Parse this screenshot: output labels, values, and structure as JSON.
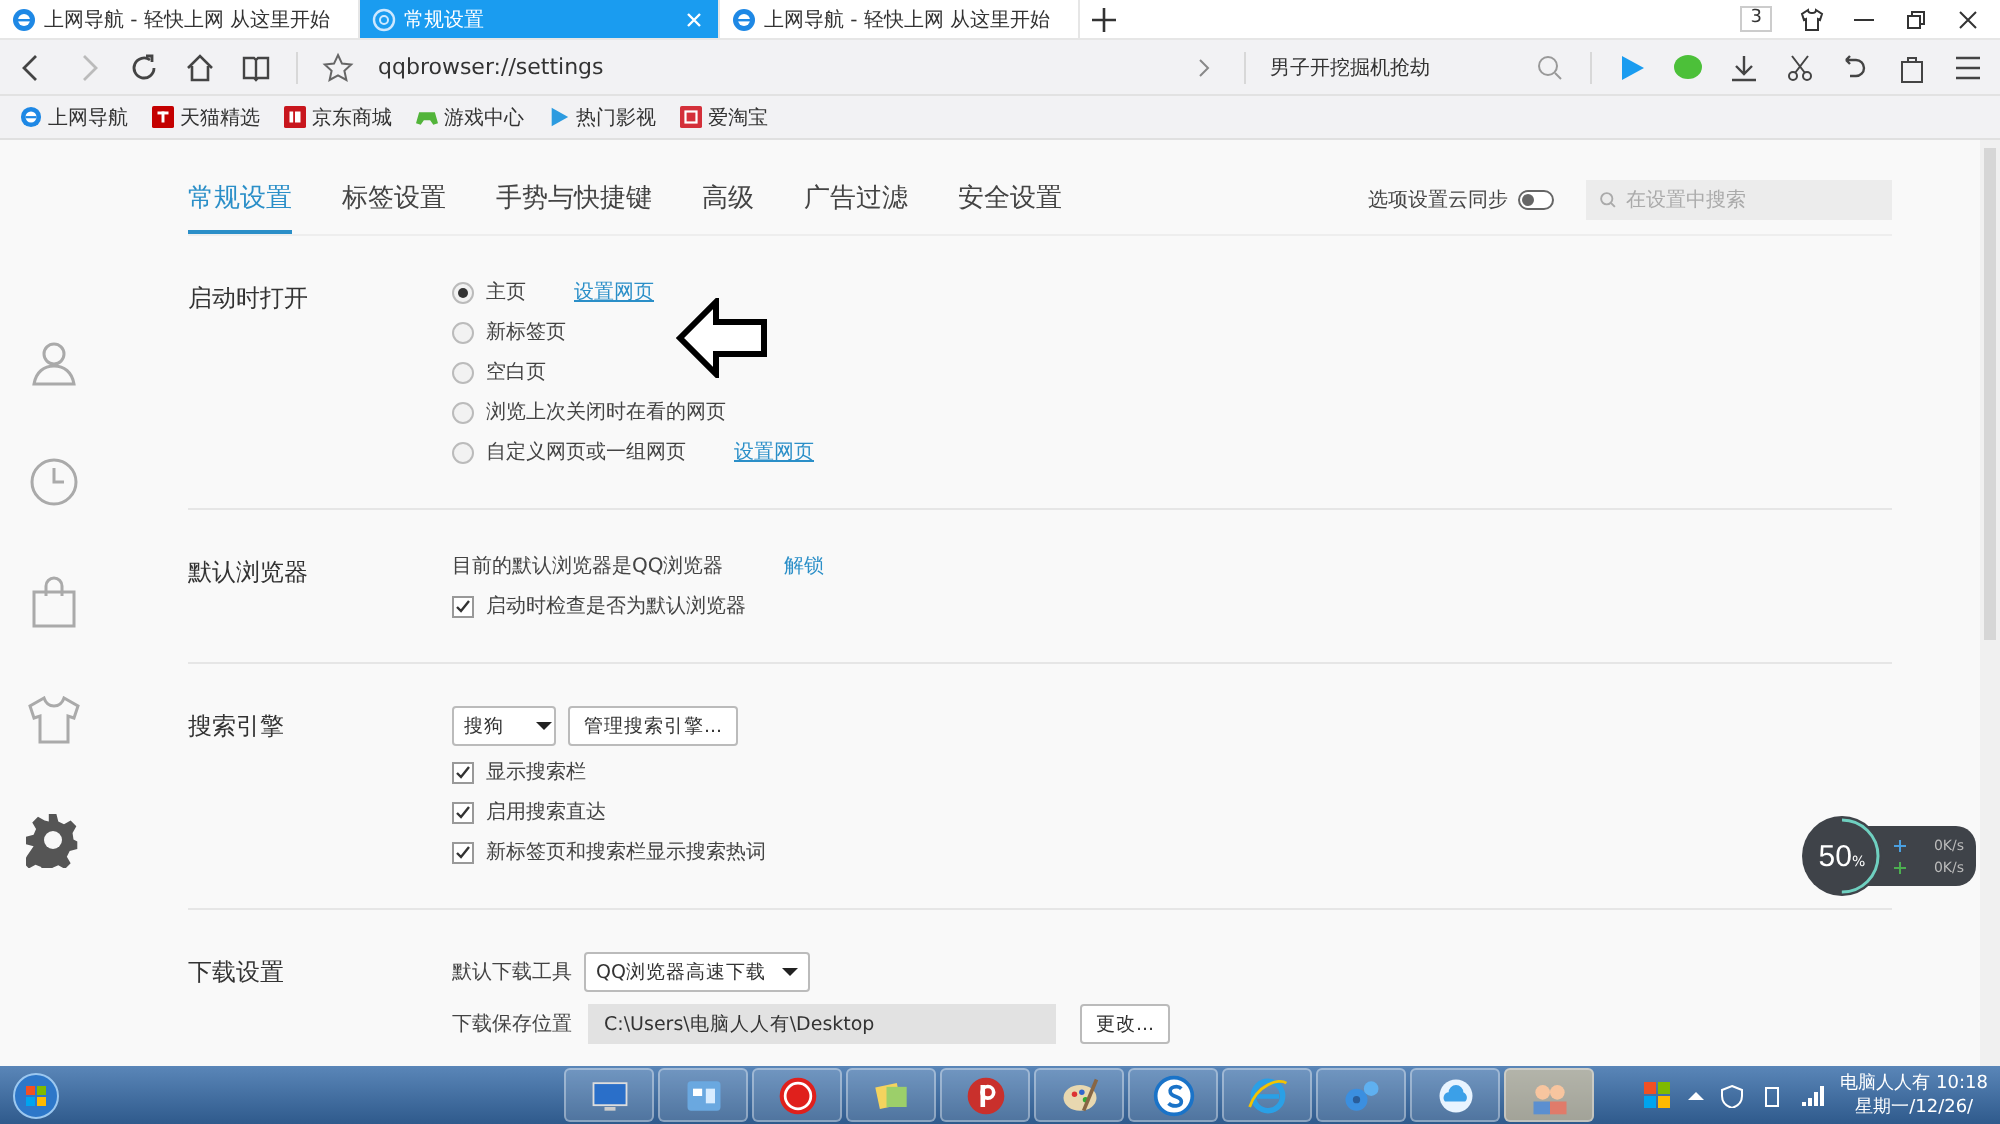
{
  "tabs": [
    {
      "title": "上网导航 - 轻快上网 从这里开始",
      "selected": false
    },
    {
      "title": "常规设置",
      "selected": true
    },
    {
      "title": "上网导航 - 轻快上网 从这里开始",
      "selected": false
    }
  ],
  "window_controls": {
    "tab_count": "3"
  },
  "address_bar": {
    "url": "qqbrowser://settings",
    "search_value": "男子开挖掘机抢劫"
  },
  "bookmarks": [
    "上网导航",
    "天猫精选",
    "京东商城",
    "游戏中心",
    "热门影视",
    "爱淘宝"
  ],
  "sidebar": [
    {
      "selected": false
    },
    {
      "selected": false
    },
    {
      "selected": false
    },
    {
      "selected": false
    },
    {
      "selected": true
    }
  ],
  "settings_tabs": [
    {
      "label": "常规设置",
      "selected": true
    },
    {
      "label": "标签设置",
      "selected": false
    },
    {
      "label": "手势与快捷键",
      "selected": false
    },
    {
      "label": "高级",
      "selected": false
    },
    {
      "label": "广告过滤",
      "selected": false
    },
    {
      "label": "安全设置",
      "selected": false
    }
  ],
  "sync": {
    "label": "选项设置云同步",
    "on": false
  },
  "search": {
    "placeholder": "在设置中搜索"
  },
  "sections": [
    {
      "title": "启动时打开",
      "rows": [
        {
          "kind": "radio",
          "label": "主页",
          "selected": true,
          "link": "设置网页"
        },
        {
          "kind": "radio",
          "label": "新标签页",
          "selected": false
        },
        {
          "kind": "radio",
          "label": "空白页",
          "selected": false
        },
        {
          "kind": "radio",
          "label": "浏览上次关闭时在看的网页",
          "selected": false
        },
        {
          "kind": "radio",
          "label": "自定义网页或一组网页",
          "selected": false,
          "link": "设置网页"
        }
      ]
    },
    {
      "title": "默认浏览器",
      "rows": [
        {
          "kind": "text",
          "label": "目前的默认浏览器是QQ浏览器",
          "link": "解锁"
        },
        {
          "kind": "checkbox",
          "label": "启动时检查是否为默认浏览器",
          "checked": true
        }
      ]
    },
    {
      "title": "搜索引擎",
      "rows": [
        {
          "kind": "controls",
          "select": "搜狗",
          "button": "管理搜索引擎..."
        },
        {
          "kind": "checkbox",
          "label": "显示搜索栏",
          "checked": true
        },
        {
          "kind": "checkbox",
          "label": "启用搜索直达",
          "checked": true
        },
        {
          "kind": "checkbox",
          "label": "新标签页和搜索栏显示搜索热词",
          "checked": true
        }
      ]
    },
    {
      "title": "下载设置",
      "rows": [
        {
          "kind": "select",
          "label": "默认下载工具",
          "select": "QQ浏览器高速下载"
        },
        {
          "kind": "path",
          "label": "下载保存位置",
          "value": "C:\\Users\\电脑人人有\\Desktop",
          "button": "更改..."
        }
      ]
    }
  ],
  "speed_widget": {
    "percent": "50",
    "unit": "%",
    "upload": "0K/s",
    "download": "0K/s",
    "level": 0.5
  },
  "taskbar": {
    "apps": [
      {
        "selected": false
      },
      {
        "selected": false
      },
      {
        "selected": false
      },
      {
        "selected": false
      },
      {
        "selected": false
      },
      {
        "selected": false
      },
      {
        "selected": false
      },
      {
        "selected": false
      },
      {
        "selected": false
      },
      {
        "selected": false
      },
      {
        "selected": true
      }
    ],
    "clock": {
      "line1": "电脑人人有 10:18",
      "line2": "星期一/12/26/"
    }
  }
}
